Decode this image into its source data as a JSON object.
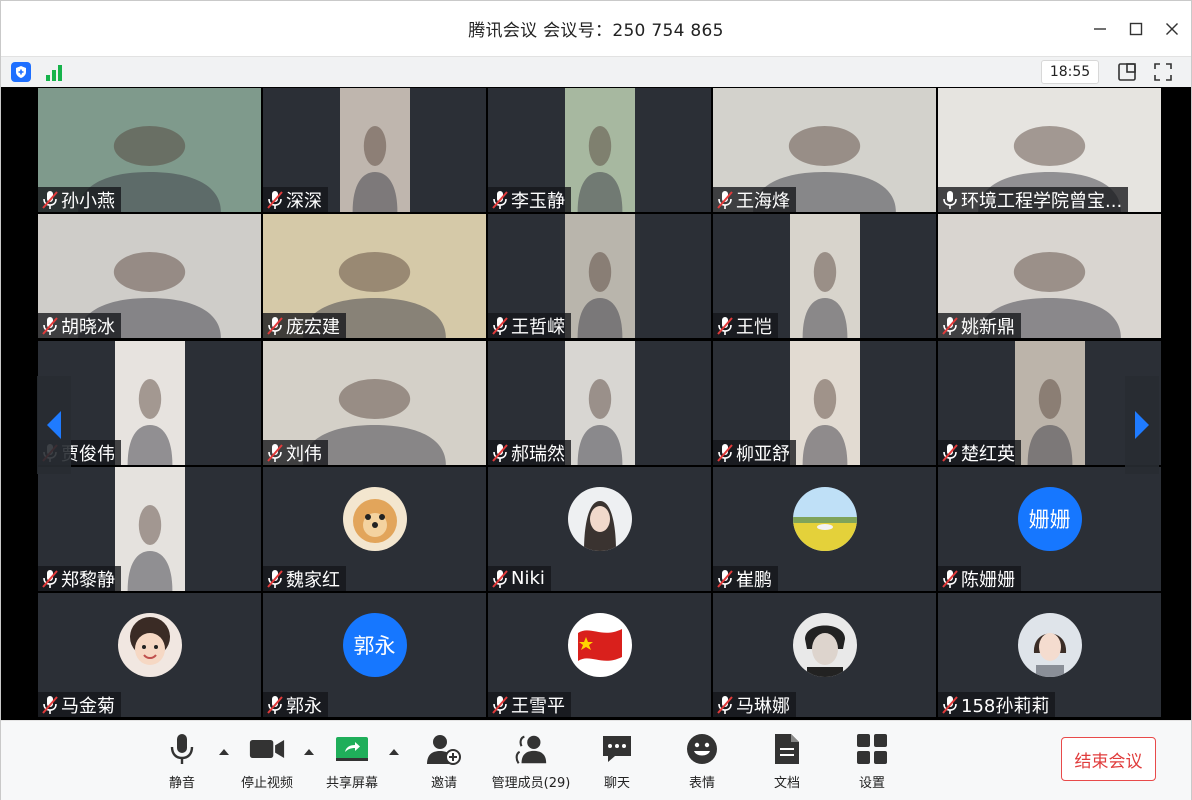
{
  "window": {
    "title": "腾讯会议 会议号：250 754 865"
  },
  "statusbar": {
    "time": "18:55",
    "shield_icon": "shield-icon",
    "signal_icon": "signal-icon"
  },
  "colors": {
    "accent": "#1677ff",
    "end_meeting": "#e03c3c",
    "tile_bg": "#2b2f36",
    "signal_green": "#16b34b"
  },
  "participants": [
    {
      "name": "孙小燕",
      "mic": "muted",
      "type": "video",
      "bg": "#7f9a8c"
    },
    {
      "name": "深深",
      "mic": "muted",
      "type": "video",
      "bg": "#bfb6ae"
    },
    {
      "name": "李玉静",
      "mic": "muted",
      "type": "video",
      "bg": "#a7b8a0"
    },
    {
      "name": "王海烽",
      "mic": "muted",
      "type": "video",
      "bg": "#d3d2cc"
    },
    {
      "name": "环境工程学院曾宝...",
      "mic": "on",
      "type": "video",
      "bg": "#e6e4e0"
    },
    {
      "name": "胡晓冰",
      "mic": "muted",
      "type": "video",
      "bg": "#cfcdc9"
    },
    {
      "name": "庞宏建",
      "mic": "muted",
      "type": "video",
      "bg": "#d5c9a8"
    },
    {
      "name": "王哲嵘",
      "mic": "muted",
      "type": "video",
      "bg": "#b9b5ac"
    },
    {
      "name": "王恺",
      "mic": "muted",
      "type": "video",
      "bg": "#d8d4cc"
    },
    {
      "name": "姚新鼎",
      "mic": "muted",
      "type": "video",
      "bg": "#d9d5d0"
    },
    {
      "name": "贾俊伟",
      "mic": "muted",
      "type": "video",
      "bg": "#e7e3df"
    },
    {
      "name": "刘伟",
      "mic": "muted",
      "type": "video",
      "bg": "#d4d0c8"
    },
    {
      "name": "郝瑞然",
      "mic": "muted",
      "type": "video",
      "bg": "#d8d6d2"
    },
    {
      "name": "柳亚舒",
      "mic": "muted",
      "type": "video",
      "bg": "#e2dbd2"
    },
    {
      "name": "楚红英",
      "mic": "muted",
      "type": "video",
      "bg": "#bcb4aa"
    },
    {
      "name": "郑黎静",
      "mic": "muted",
      "type": "video",
      "bg": "#e5e2de"
    },
    {
      "name": "魏家红",
      "mic": "muted",
      "type": "avatar",
      "avatar": "dog-photo"
    },
    {
      "name": "Niki",
      "mic": "muted",
      "type": "avatar",
      "avatar": "girl-photo"
    },
    {
      "name": "崔鹏",
      "mic": "muted",
      "type": "avatar",
      "avatar": "flower-field-photo"
    },
    {
      "name": "陈姗姗",
      "mic": "muted",
      "type": "avatar",
      "avatar_text": "姗姗"
    },
    {
      "name": "马金菊",
      "mic": "muted",
      "type": "avatar",
      "avatar": "baby-photo"
    },
    {
      "name": "郭永",
      "mic": "muted",
      "type": "avatar",
      "avatar_text": "郭永"
    },
    {
      "name": "王雪平",
      "mic": "muted",
      "type": "avatar",
      "avatar": "flag-photo"
    },
    {
      "name": "马琳娜",
      "mic": "muted",
      "type": "avatar",
      "avatar": "man-photo"
    },
    {
      "name": "158孙莉莉",
      "mic": "muted",
      "type": "avatar",
      "avatar": "woman-photo"
    }
  ],
  "toolbar": {
    "mute": "静音",
    "stop_video": "停止视频",
    "share_screen": "共享屏幕",
    "invite": "邀请",
    "manage_members": "管理成员(29)",
    "chat": "聊天",
    "reactions": "表情",
    "documents": "文档",
    "settings": "设置",
    "end_meeting": "结束会议"
  }
}
